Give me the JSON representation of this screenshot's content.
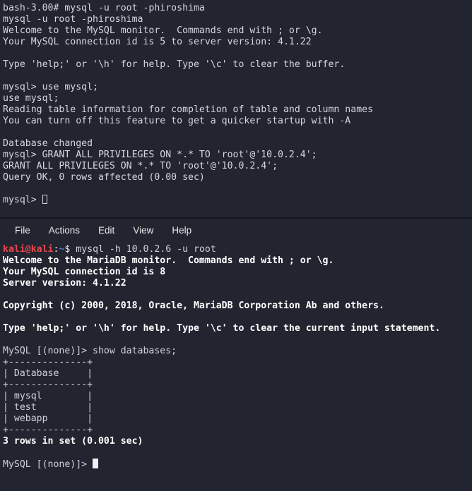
{
  "colors": {
    "background": "#222530",
    "foreground": "#cfd2da",
    "bold_foreground": "#ffffff",
    "prompt_user_host": "#e5484d",
    "prompt_path": "#4e7fd1",
    "divider": "#14161d",
    "cursor": "#f0f0f0"
  },
  "top_terminal": {
    "name": "mysql-session-solaris",
    "lines": [
      {
        "text": "bash-3.00# mysql -u root -phiroshima",
        "style": "plain"
      },
      {
        "text": "mysql -u root -phiroshima",
        "style": "plain"
      },
      {
        "text": "Welcome to the MySQL monitor.  Commands end with ; or \\g.",
        "style": "plain"
      },
      {
        "text": "Your MySQL connection id is 5 to server version: 4.1.22",
        "style": "plain"
      },
      {
        "text": "",
        "style": "blank"
      },
      {
        "text": "Type 'help;' or '\\h' for help. Type '\\c' to clear the buffer.",
        "style": "plain"
      },
      {
        "text": "",
        "style": "blank"
      },
      {
        "text": "mysql> use mysql;",
        "style": "plain"
      },
      {
        "text": "use mysql;",
        "style": "plain"
      },
      {
        "text": "Reading table information for completion of table and column names",
        "style": "plain"
      },
      {
        "text": "You can turn off this feature to get a quicker startup with -A",
        "style": "plain"
      },
      {
        "text": "",
        "style": "blank"
      },
      {
        "text": "Database changed",
        "style": "plain"
      },
      {
        "text": "mysql> GRANT ALL PRIVILEGES ON *.* TO 'root'@'10.0.2.4';",
        "style": "plain"
      },
      {
        "text": "GRANT ALL PRIVILEGES ON *.* TO 'root'@'10.0.2.4';",
        "style": "plain"
      },
      {
        "text": "Query OK, 0 rows affected (0.00 sec)",
        "style": "plain"
      },
      {
        "text": "",
        "style": "blank"
      }
    ],
    "final_prompt": "mysql> ",
    "cursor_type": "hollow"
  },
  "bottom_terminal": {
    "name": "kali-terminal",
    "menubar": {
      "items": [
        {
          "label": "File",
          "name": "menu-file"
        },
        {
          "label": "Actions",
          "name": "menu-actions"
        },
        {
          "label": "Edit",
          "name": "menu-edit"
        },
        {
          "label": "View",
          "name": "menu-view"
        },
        {
          "label": "Help",
          "name": "menu-help"
        }
      ]
    },
    "prompt": {
      "user_host": "kali@kali",
      "separator": ":",
      "path": "~",
      "sigil": "$",
      "command": " mysql -h 10.0.2.6 -u root"
    },
    "lines": [
      {
        "text": "Welcome to the MariaDB monitor.  Commands end with ; or \\g.",
        "style": "bold"
      },
      {
        "text": "Your MySQL connection id is 8",
        "style": "bold"
      },
      {
        "text": "Server version: 4.1.22",
        "style": "bold"
      },
      {
        "text": "",
        "style": "blank"
      },
      {
        "text": "Copyright (c) 2000, 2018, Oracle, MariaDB Corporation Ab and others.",
        "style": "bold"
      },
      {
        "text": "",
        "style": "blank"
      },
      {
        "text": "Type 'help;' or '\\h' for help. Type '\\c' to clear the current input statement.",
        "style": "bold"
      },
      {
        "text": "",
        "style": "blank"
      },
      {
        "text": "MySQL [(none)]> show databases;",
        "style": "plain"
      },
      {
        "text": "+--------------+",
        "style": "plain"
      },
      {
        "text": "| Database     |",
        "style": "plain"
      },
      {
        "text": "+--------------+",
        "style": "plain"
      },
      {
        "text": "| mysql        |",
        "style": "plain"
      },
      {
        "text": "| test         |",
        "style": "plain"
      },
      {
        "text": "| webapp       |",
        "style": "plain"
      },
      {
        "text": "+--------------+",
        "style": "plain"
      },
      {
        "text": "3 rows in set (0.001 sec)",
        "style": "bold"
      },
      {
        "text": "",
        "style": "blank"
      }
    ],
    "query_result": {
      "type": "table",
      "columns": [
        "Database"
      ],
      "rows": [
        [
          "mysql"
        ],
        [
          "test"
        ],
        [
          "webapp"
        ]
      ],
      "row_count_text": "3 rows in set (0.001 sec)",
      "command": "show databases;"
    },
    "final_prompt": "MySQL [(none)]> ",
    "cursor_type": "block"
  }
}
